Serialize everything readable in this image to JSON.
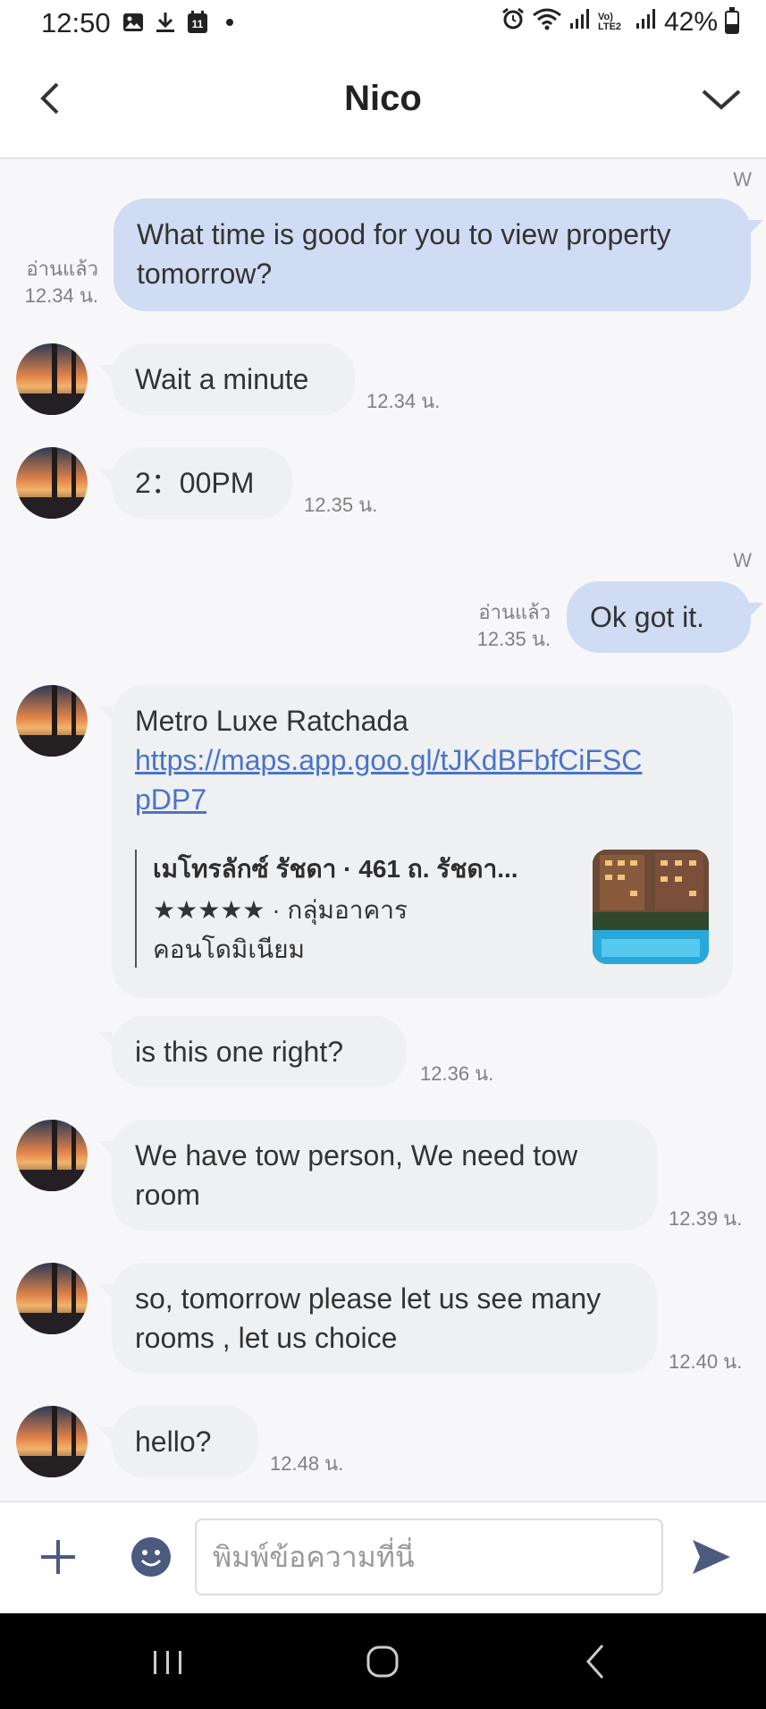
{
  "status_bar": {
    "time": "12:50",
    "left_icons": [
      "gallery-icon",
      "download-icon",
      "calendar-icon",
      "dot-icon"
    ],
    "calendar_day": "11",
    "right_icons": [
      "alarm-icon",
      "wifi-icon",
      "signal-icon",
      "volte-icon",
      "signal-icon",
      "battery-icon"
    ],
    "volte_text": "Vo) LTE2",
    "battery": "42%",
    "battery_level": 0.42
  },
  "header": {
    "title": "Nico",
    "back_icon": "chevron-left-icon",
    "menu_icon": "chevron-down-icon"
  },
  "messages": [
    {
      "type": "sent",
      "text": "What time is good for you to view property tomorrow?",
      "read_label": "อ่านแล้ว",
      "time": "12.34 น.",
      "mark": "W"
    },
    {
      "type": "received",
      "text": "Wait a minute",
      "time": "12.34 น."
    },
    {
      "type": "received",
      "text": "2：00PM",
      "time": "12.35 น."
    },
    {
      "type": "sent",
      "text": "Ok got it.",
      "read_label": "อ่านแล้ว",
      "time": "12.35 น.",
      "mark": "W"
    },
    {
      "type": "received_link",
      "text": "Metro Luxe Ratchada",
      "link": "https://maps.app.goo.gl/tJKdBFbfCiFSCpDP7",
      "link_line1": "https://maps.app.goo.gl/tJKdBFbfCiFSC",
      "link_line2": "pDP7",
      "card": {
        "title": "เมโทรลักซ์ รัชดา · 461 ถ. รัชดา...",
        "rating": "★★★★★",
        "category": " · กลุ่มอาคาร",
        "subcategory": "คอนโดมิเนียม"
      }
    },
    {
      "type": "received",
      "text": "is this one right?",
      "time": "12.36 น."
    },
    {
      "type": "received",
      "text": "We have tow person, We need tow room",
      "time": "12.39 น."
    },
    {
      "type": "received",
      "text": "so, tomorrow please let us see many rooms , let us choice",
      "time": "12.40 น."
    },
    {
      "type": "received",
      "text": "hello?",
      "time": "12.48 น."
    }
  ],
  "input": {
    "placeholder": "พิมพ์ข้อความที่นี่",
    "value": "",
    "plus_icon": "plus-icon",
    "emoji_icon": "emoji-icon",
    "send_icon": "send-icon"
  },
  "nav": {
    "recent_icon": "recent-apps-icon",
    "home_icon": "home-icon",
    "back_icon": "back-icon"
  },
  "colors": {
    "sent_bubble": "#cfdcf3",
    "received_bubble": "#eff0f2",
    "link": "#4a74c9",
    "chat_bg": "#f7f7f9"
  }
}
